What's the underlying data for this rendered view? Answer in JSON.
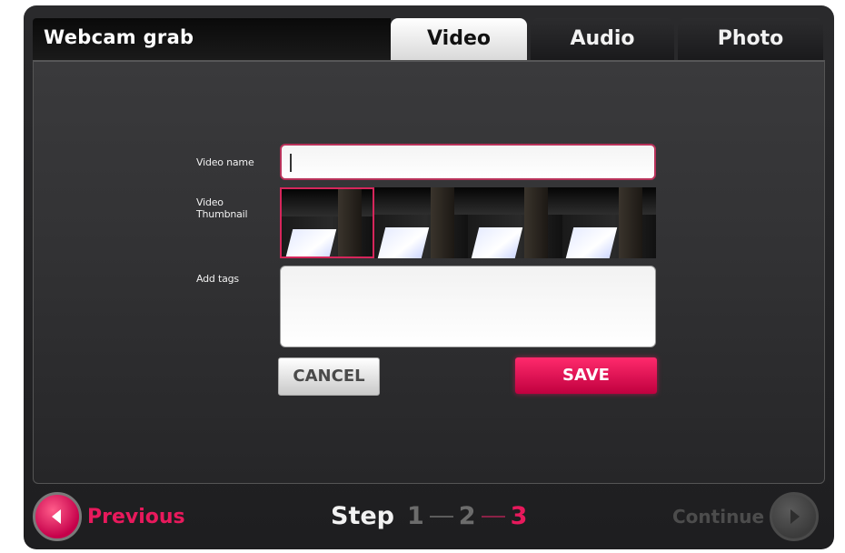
{
  "window": {
    "title": "Webcam grab"
  },
  "tabs": [
    {
      "label": "Video",
      "active": true
    },
    {
      "label": "Audio",
      "active": false
    },
    {
      "label": "Photo",
      "active": false
    }
  ],
  "form": {
    "video_name_label": "Video name",
    "video_name_value": "",
    "thumbnail_label_line1": "Video",
    "thumbnail_label_line2": "Thumbnail",
    "thumbnails_count": 4,
    "selected_thumbnail_index": 0,
    "tags_label": "Add tags",
    "tags_value": ""
  },
  "buttons": {
    "cancel": "CANCEL",
    "save": "SAVE"
  },
  "footer": {
    "previous": "Previous",
    "continue": "Continue",
    "step_word": "Step",
    "steps": [
      "1",
      "2",
      "3"
    ],
    "current_step": "3"
  },
  "colors": {
    "accent": "#e8195c",
    "tab_active_bg": "#ffffff",
    "panel_bg": "#333335"
  },
  "icons": {
    "previous": "arrow-left-icon",
    "continue": "arrow-right-icon"
  }
}
